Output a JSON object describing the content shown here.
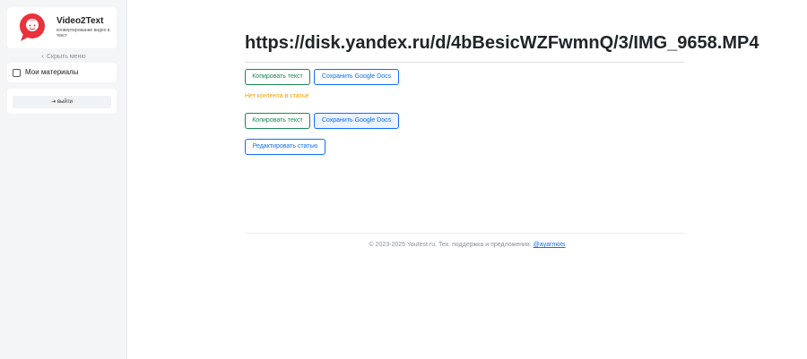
{
  "sidebar": {
    "brand": {
      "name": "Video2Text",
      "tagline": "конвертирование видео в текст"
    },
    "hide_menu_label": "Скрыть меню",
    "nav_items": [
      {
        "label": "Мои материалы"
      }
    ],
    "logout_label": "выйти"
  },
  "main": {
    "title": "https://disk.yandex.ru/d/4bBesicWZFwmnQ/3/IMG_9658.MP4",
    "copy_text_label": "Копировать текст",
    "save_google_docs_label": "Сохранить Google Docs",
    "no_content_notice": "Нет контента в статье",
    "copy_text_label_2": "Копировать текст",
    "save_google_docs_label_2": "Сохранить Google Docs",
    "edit_article_label": "Редактировать статью"
  },
  "footer": {
    "text": "© 2023-2025 Youtest.ru. Тех. поддержка и предложения:",
    "link_text": "@ayarmots"
  },
  "colors": {
    "accent_green": "#198754",
    "accent_blue": "#0d6efd",
    "warning": "#f0a000",
    "logo_red": "#e8323c"
  }
}
